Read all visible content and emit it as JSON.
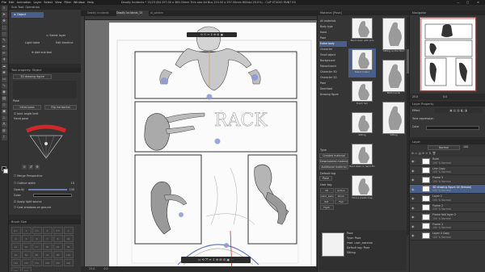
{
  "titlebar": {
    "menu_items": [
      "File",
      "Edit",
      "Animation",
      "Layer",
      "Select",
      "View",
      "Filter",
      "Window",
      "Help"
    ],
    "title": "Deadly Incidents * 15/23 (B4 257.00 x 364.00mm Trim size A4 Bus 210.00 x 297.00mm 600dpi 25.0%) - CLIP STUDIO PAINT EX",
    "win_min": "—",
    "win_max": "▢",
    "win_close": "✕"
  },
  "doc_tabs": [
    "Deadly Incidents",
    "Deadly Incidents_15",
    "dl_pattern"
  ],
  "sub_tool": {
    "header": "Sub Tool: Operation",
    "object_label": "Object",
    "select_layer": "Select layer",
    "light_table": "Light table",
    "edit_timeline": "Edit timeline",
    "add_sub_tool": "Add sub tool"
  },
  "tool_property": {
    "header": "Tool property: Object",
    "object_selector": "3D drawing figure",
    "pose_label": "Pose",
    "initial_pose": "Initial pose",
    "flip_horizontal": "Flip horizontal",
    "joint_angle_limit": "Joint angle limit",
    "hand_pose": "Hand pose",
    "merge_perspective": "Merge Perspective",
    "outline_width": "Outline width",
    "outline_value": "10",
    "opacity_label": "Opacity",
    "opacity_value": "100",
    "color_label": "Color",
    "apply_light": "Apply light source",
    "cast_shadow": "Cast shadows on ground"
  },
  "brush_size": {
    "header": "Brush Size",
    "sizes": [
      "0.7",
      "1",
      "1.5",
      "2",
      "2.5",
      "3",
      "4",
      "5",
      "6",
      "7",
      "8",
      "10",
      "12",
      "15",
      "17",
      "20",
      "25",
      "30",
      "40",
      "50",
      "60",
      "70",
      "80",
      "100",
      "120",
      "150",
      "170",
      "200",
      "250",
      "300",
      "400",
      "500"
    ]
  },
  "canvas": {
    "zoom": "25.0",
    "angle": "0.0",
    "ruler_left": "1",
    "ruler_right": "2"
  },
  "material": {
    "header": "Material [Pose]",
    "tree": [
      "All materials",
      "Body type",
      "Hand",
      "Pose",
      "Entire body",
      "Character",
      "Small object",
      "Background",
      "Monochrome",
      "Character 3D",
      "Character 2D",
      "Pose",
      "Download",
      "Drawing figure"
    ],
    "selected_tree": "Pose",
    "items": [
      "Bend down with arm",
      "Stand (main)",
      "Touch hair",
      "Sitting",
      "Bent down in hand 3D",
      "Hold a plastic bag"
    ],
    "right_items": [
      "Sitting on the floor",
      "Both hands",
      "Sitting"
    ],
    "info": {
      "type_label": "Type",
      "type_value": "Pose",
      "created": "Created material",
      "downloaded": "Downloaded material",
      "additional": "Additional material",
      "default_tag_label": "Default tag",
      "tag_pose": "Pose",
      "user_tag_label": "User tag",
      "tags": [
        "3D",
        "Action",
        "Calm_behavior",
        "Drink",
        "Eat",
        "Fall",
        "Fight"
      ]
    },
    "detail": {
      "name": "Pose",
      "type_line": "Type: Pose",
      "path": "Path: User_Material",
      "default_tag": "Default tag: Pose",
      "tag2": "Sitting"
    }
  },
  "navigator": {
    "header": "Navigator",
    "zoom": "25.0",
    "angle": "0.0"
  },
  "layer_property": {
    "header": "Layer Property",
    "effect_label": "Effect",
    "tone_label": "Tone expression",
    "expression": "Color"
  },
  "layer_panel": {
    "header": "Layer",
    "blend_mode": "Normal",
    "opacity": "100",
    "layers": [
      {
        "name": "Ruler",
        "mode": "100 % Normal",
        "selected": false
      },
      {
        "name": "Line Copy",
        "mode": "100 % Normal",
        "selected": false
      },
      {
        "name": "Frame 3",
        "mode": "100 % Normal",
        "selected": false
      },
      {
        "name": "3D drawing figure 44 (female)",
        "mode": "100 % Normal",
        "selected": true
      },
      {
        "name": "Layer 1",
        "mode": "100 % Normal",
        "selected": false
      },
      {
        "name": "Frame 2",
        "mode": "100 % Normal",
        "selected": false
      },
      {
        "name": "Frame fold layer 2",
        "mode": "100 % Normal",
        "selected": false
      },
      {
        "name": "Frame 1",
        "mode": "100 % Normal",
        "selected": false
      },
      {
        "name": "Layer 4 Copy",
        "mode": "100 % Normal",
        "selected": false
      }
    ]
  },
  "colors": {
    "accent": "#4a5e8a",
    "panel": "#353535",
    "bg": "#2b2b2b",
    "blue_marker": "#8a96d8",
    "red_pencil": "#e03030"
  }
}
